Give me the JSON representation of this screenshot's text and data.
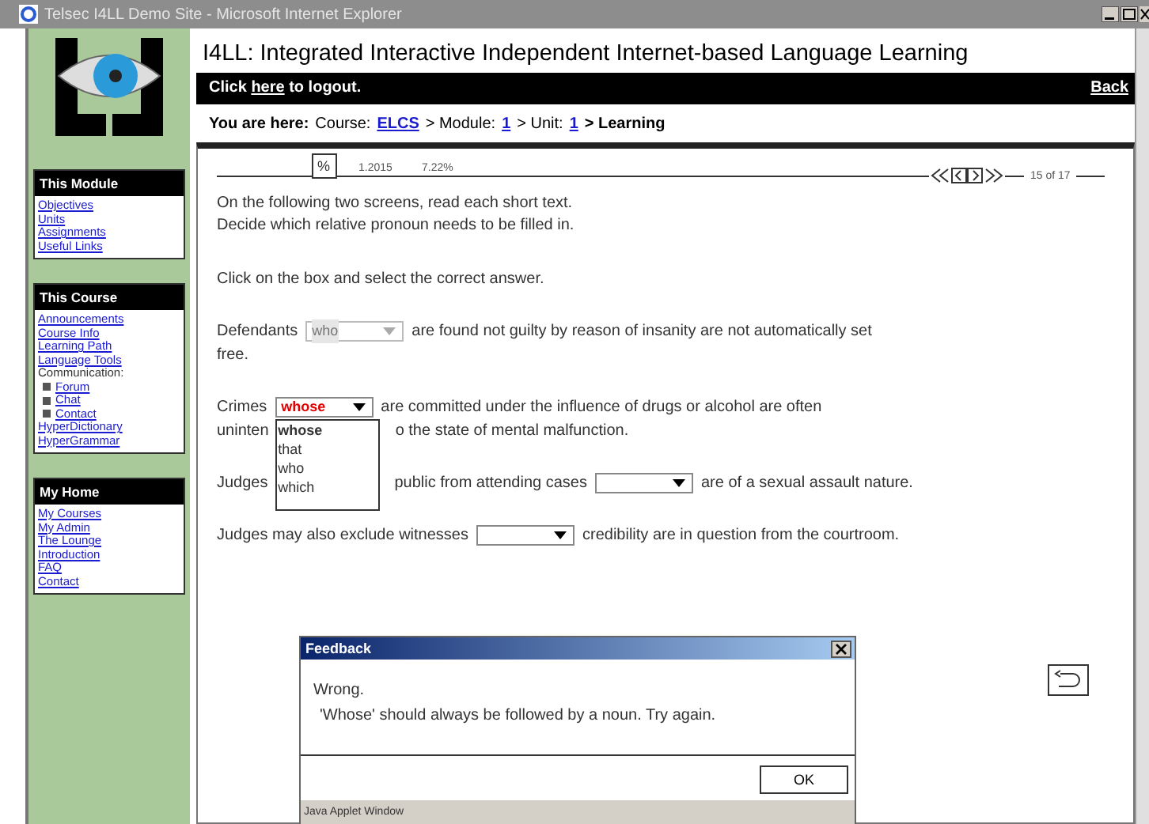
{
  "window": {
    "title": "Telsec I4LL Demo Site - Microsoft Internet Explorer"
  },
  "header": {
    "title": "I4LL: Integrated Interactive Independent Internet-based Language Learning",
    "logout": [
      {
        "kind": "text",
        "text": "Click "
      },
      {
        "kind": "link",
        "text": "here"
      },
      {
        "kind": "text",
        "text": " to logout."
      }
    ],
    "back": "Back"
  },
  "breadcrumb": [
    {
      "kind": "label",
      "text": "You are here:"
    },
    {
      "kind": "text",
      "text": "Course:"
    },
    {
      "kind": "link",
      "text": "ELCS"
    },
    {
      "kind": "text",
      "text": "> Module:"
    },
    {
      "kind": "link",
      "text": "1"
    },
    {
      "kind": "text",
      "text": "> Unit:"
    },
    {
      "kind": "link",
      "text": "1"
    },
    {
      "kind": "current",
      "text": "> Learning"
    }
  ],
  "sidebar": [
    {
      "title": "This Module",
      "items": [
        {
          "kind": "link",
          "label": "Objectives"
        },
        {
          "kind": "link",
          "label": "Units"
        },
        {
          "kind": "link",
          "label": "Assignments"
        },
        {
          "kind": "link",
          "label": "Useful Links"
        }
      ]
    },
    {
      "title": "This Course",
      "items": [
        {
          "kind": "link",
          "label": "Announcements"
        },
        {
          "kind": "link",
          "label": "Course Info"
        },
        {
          "kind": "link",
          "label": "Learning Path"
        },
        {
          "kind": "link",
          "label": "Language Tools"
        },
        {
          "kind": "text",
          "label": "Communication:"
        },
        {
          "kind": "bullet",
          "label": "Forum"
        },
        {
          "kind": "bullet",
          "label": "Chat"
        },
        {
          "kind": "bullet",
          "label": "Contact"
        },
        {
          "kind": "link",
          "label": "HyperDictionary"
        },
        {
          "kind": "link",
          "label": "HyperGrammar"
        }
      ]
    },
    {
      "title": "My Home",
      "items": [
        {
          "kind": "link",
          "label": "My Courses"
        },
        {
          "kind": "link",
          "label": "My Admin"
        },
        {
          "kind": "link",
          "label": "The Lounge"
        },
        {
          "kind": "link",
          "label": "Introduction"
        },
        {
          "kind": "link",
          "label": "FAQ"
        },
        {
          "kind": "link",
          "label": "Contact"
        }
      ]
    }
  ],
  "progress": {
    "button": "%",
    "size": "1.2015",
    "percent": "7.22%",
    "page": "15 of 17",
    "level": 0.15
  },
  "intro": [
    "On the following two screens, read each short text.",
    "Decide which relative pronoun needs to be filled in."
  ],
  "instruction": "Click on the box and select the correct answer.",
  "questions": [
    {
      "lines": [
        [
          {
            "kind": "text",
            "text": "Defendants"
          },
          {
            "kind": "select",
            "value": "who",
            "disabled": true
          },
          {
            "kind": "text",
            "text": "are found not guilty by reason of insanity are not automatically set"
          }
        ],
        [
          {
            "kind": "text",
            "text": "free."
          }
        ]
      ]
    },
    {
      "lines": [
        [
          {
            "kind": "text",
            "text": "Crimes"
          },
          {
            "kind": "select",
            "value": "whose",
            "disabled": false,
            "wrong": true,
            "expanded": true,
            "options": [
              {
                "label": "whose",
                "selected": true
              },
              {
                "label": "that",
                "selected": false
              },
              {
                "label": "who",
                "selected": false
              },
              {
                "label": "which",
                "selected": false
              }
            ]
          },
          {
            "kind": "text",
            "text": "are committed under the influence of drugs or alcohol are often"
          }
        ],
        [
          {
            "kind": "text",
            "text": "uninten"
          },
          {
            "kind": "covered"
          },
          {
            "kind": "text",
            "text": "o the state of mental malfunction."
          }
        ]
      ]
    },
    {
      "lines": [
        [
          {
            "kind": "text",
            "text": "Judges"
          },
          {
            "kind": "covered"
          },
          {
            "kind": "text",
            "text": "public from attending cases"
          },
          {
            "kind": "select",
            "disabled": false
          },
          {
            "kind": "text",
            "text": "are of a sexual assault nature."
          }
        ]
      ]
    },
    {
      "lines": [
        [
          {
            "kind": "text",
            "text": "Judges may also exclude witnesses"
          },
          {
            "kind": "select",
            "disabled": false
          },
          {
            "kind": "text",
            "text": "credibility are in question from the courtroom."
          }
        ]
      ]
    }
  ],
  "dialog": {
    "title": "Feedback",
    "lines": [
      "Wrong.",
      "'Whose' should always be followed by a noun. Try again."
    ],
    "button": "OK",
    "footer": "Java Applet Window"
  }
}
